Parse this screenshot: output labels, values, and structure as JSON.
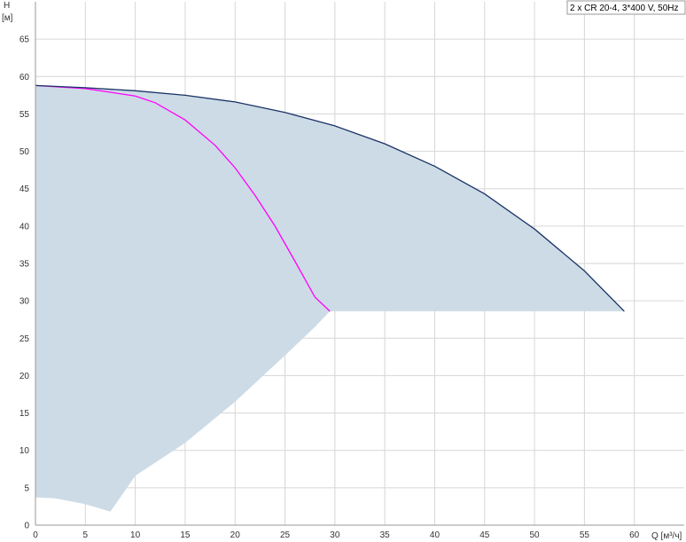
{
  "legend": {
    "title": "2 x CR 20-4, 3*400 V, 50Hz"
  },
  "colors": {
    "operating_area": "#cddbe6",
    "max_curve": "#1a3366",
    "single_curve": "#ff00ff",
    "grid": "#d6d6d6",
    "axis": "#999999"
  },
  "chart_data": {
    "type": "line",
    "title": "2 x CR 20-4, 3*400 V, 50Hz",
    "xlabel": "Q [м³/ч]",
    "ylabel": "H",
    "ylabel_unit": "[м]",
    "xlim": [
      0,
      65
    ],
    "ylim": [
      0,
      70
    ],
    "x_ticks": [
      0,
      5,
      10,
      15,
      20,
      25,
      30,
      35,
      40,
      45,
      50,
      55,
      60
    ],
    "y_ticks": [
      0,
      5,
      10,
      15,
      20,
      25,
      30,
      35,
      40,
      45,
      50,
      55,
      60,
      65
    ],
    "grid": true,
    "legend_position": "top-right",
    "operating_area_boundary": [
      [
        0,
        58.8
      ],
      [
        5,
        58.5
      ],
      [
        10,
        58.1
      ],
      [
        15,
        57.5
      ],
      [
        20,
        56.6
      ],
      [
        25,
        55.2
      ],
      [
        30,
        53.4
      ],
      [
        35,
        51.0
      ],
      [
        40,
        48.0
      ],
      [
        45,
        44.3
      ],
      [
        50,
        39.6
      ],
      [
        55,
        34.0
      ],
      [
        59,
        28.6
      ],
      [
        29.5,
        28.6
      ],
      [
        28,
        26.5
      ],
      [
        25,
        22.7
      ],
      [
        20,
        16.5
      ],
      [
        15,
        11.0
      ],
      [
        10,
        6.6
      ],
      [
        7.5,
        1.8
      ],
      [
        5,
        2.8
      ],
      [
        2,
        3.6
      ],
      [
        0,
        3.7
      ]
    ],
    "series": [
      {
        "values": [
          [
            0,
            58.8
          ],
          [
            5,
            58.4
          ],
          [
            10,
            57.4
          ],
          [
            12,
            56.5
          ],
          [
            15,
            54.2
          ],
          [
            18,
            50.8
          ],
          [
            20,
            47.8
          ],
          [
            22,
            44.1
          ],
          [
            24,
            40.0
          ],
          [
            26,
            35.3
          ],
          [
            28,
            30.5
          ],
          [
            29.5,
            28.6
          ]
        ]
      },
      {
        "values": [
          [
            0,
            58.8
          ],
          [
            5,
            58.5
          ],
          [
            10,
            58.1
          ],
          [
            15,
            57.5
          ],
          [
            20,
            56.6
          ],
          [
            25,
            55.2
          ],
          [
            30,
            53.4
          ],
          [
            35,
            51.0
          ],
          [
            40,
            48.0
          ],
          [
            45,
            44.3
          ],
          [
            50,
            39.6
          ],
          [
            55,
            34.0
          ],
          [
            59,
            28.6
          ]
        ]
      }
    ]
  }
}
